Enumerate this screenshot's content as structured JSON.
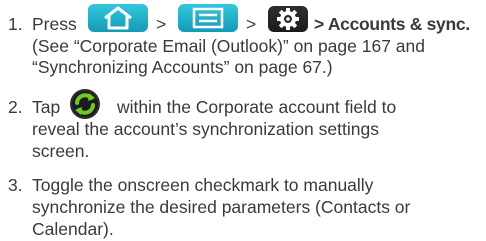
{
  "steps": [
    {
      "number": "1.",
      "press_label": "Press",
      "icons": [
        "home-key-icon",
        "menu-key-icon",
        "settings-gear-icon"
      ],
      "separator": ">",
      "destination": "> Accounts & sync.",
      "lines": [
        "(See “Corporate Email (Outlook)” on page 167 and",
        "“Synchronizing Accounts” on page 67.)"
      ]
    },
    {
      "number": "2.",
      "tap_label": "Tap",
      "icon": "sync-icon",
      "lines": [
        "within the Corporate account field to",
        "reveal the account’s synchronization settings",
        "screen."
      ]
    },
    {
      "number": "3.",
      "lines": [
        "Toggle the onscreen checkmark to manually",
        "synchronize the desired parameters (Contacts or",
        "Calendar)."
      ]
    }
  ],
  "colors": {
    "text": "#3a3a3a",
    "key_background": "#1fb0ca",
    "sync_green": "#5fbf1e"
  }
}
